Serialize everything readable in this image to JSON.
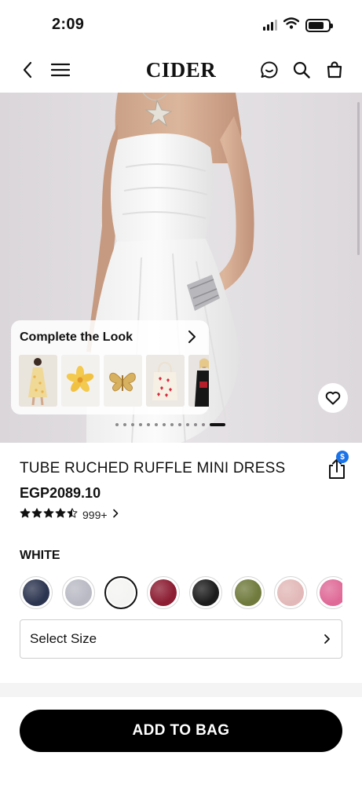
{
  "status_bar": {
    "time": "2:09",
    "battery_level": 0.8
  },
  "nav": {
    "brand": "CIDER",
    "icons": [
      "back-icon",
      "menu-icon",
      "chat-icon",
      "search-icon",
      "bag-icon"
    ]
  },
  "hero": {
    "background_color": "#e3dfe3",
    "complete_the_look": {
      "title": "Complete the Look",
      "items": [
        "yellow-floral-dress",
        "yellow-flower-hair-clip",
        "gold-butterfly-hair-clip",
        "heart-tote-bag",
        "model-black-outfit"
      ]
    },
    "carousel": {
      "total": 13,
      "active_index": 12
    }
  },
  "product": {
    "name": "TUBE RUCHED RUFFLE MINI DRESS",
    "price": "EGP2089.10",
    "rating": 4.5,
    "review_count": "999+",
    "share_badge": "$"
  },
  "color": {
    "selected_label": "WHITE",
    "swatches": [
      {
        "name": "navy",
        "color": "#2c3550"
      },
      {
        "name": "light-gray",
        "color": "#b9bac4"
      },
      {
        "name": "white",
        "color": "#f4f4f2",
        "selected": true
      },
      {
        "name": "burgundy",
        "color": "#8c1d32"
      },
      {
        "name": "black",
        "color": "#1c1c1c"
      },
      {
        "name": "olive",
        "color": "#6f7a3c"
      },
      {
        "name": "blush-pink",
        "color": "#e2b9b8"
      },
      {
        "name": "hot-pink",
        "color": "#df6a97"
      }
    ]
  },
  "size": {
    "label": "Select Size"
  },
  "cta": {
    "label": "ADD TO BAG"
  }
}
